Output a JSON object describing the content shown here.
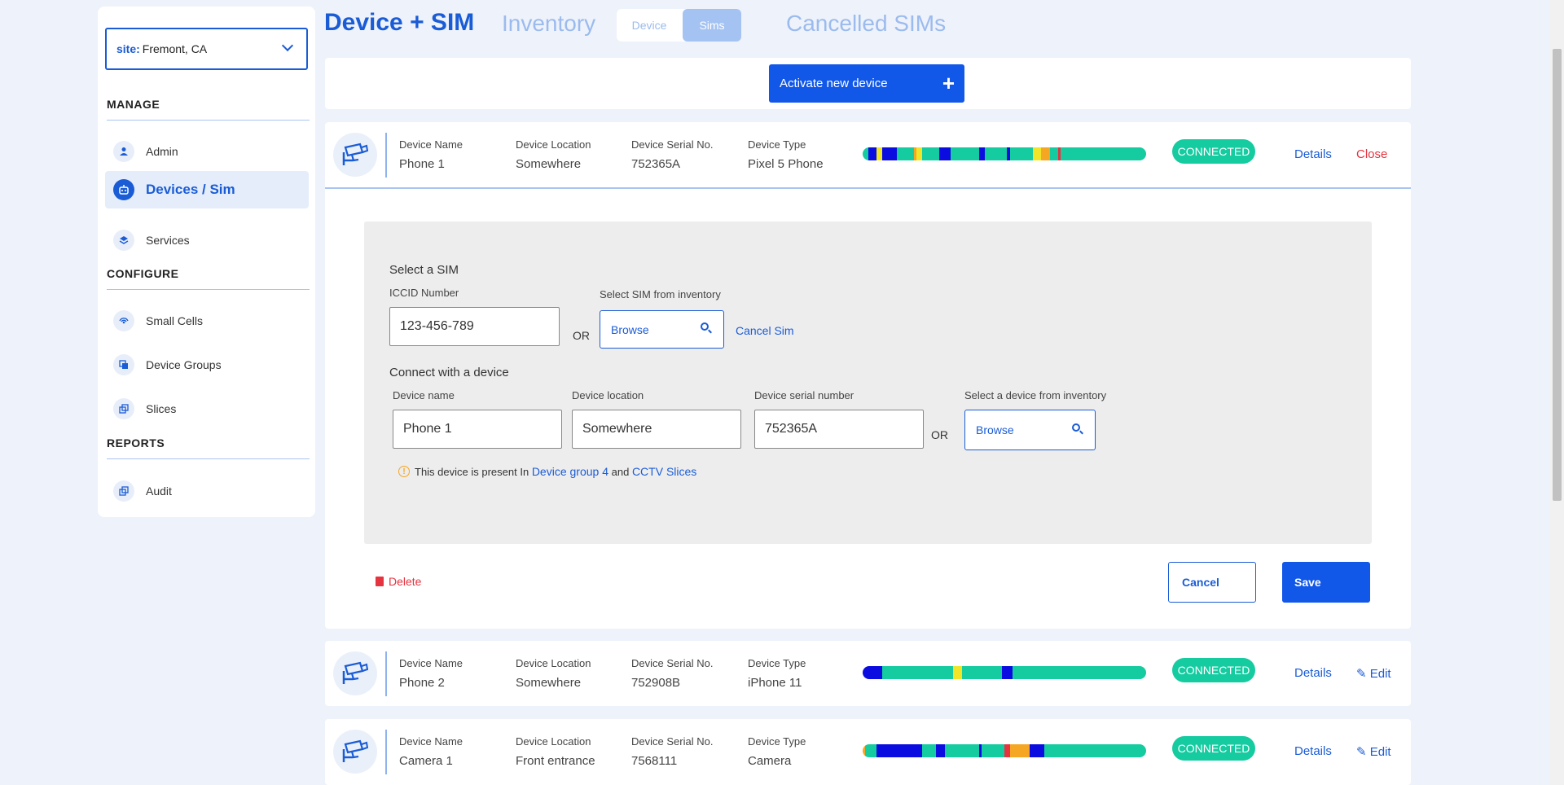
{
  "sidebar": {
    "site_label": "site:",
    "site_value": "Fremont, CA",
    "sections": {
      "manage": "MANAGE",
      "configure": "CONFIGURE",
      "reports": "REPORTS"
    },
    "items": {
      "admin": "Admin",
      "devices": "Devices / Sim",
      "services": "Services",
      "small_cells": "Small Cells",
      "device_groups": "Device Groups",
      "slices": "Slices",
      "audit": "Audit"
    }
  },
  "header": {
    "title": "Device + SIM",
    "inventory": "Inventory",
    "toggle_device": "Device",
    "toggle_sims": "Sims",
    "cancelled": "Cancelled SIMs"
  },
  "activate_button": "Activate new device",
  "field_labels": {
    "name": "Device Name",
    "location": "Device Location",
    "serial": "Device Serial No.",
    "type": "Device Type"
  },
  "devices": [
    {
      "name": "Phone 1",
      "location": "Somewhere",
      "serial": "752365A",
      "type": "Pixel 5 Phone",
      "status": "CONNECTED",
      "details": "Details",
      "action": "Close",
      "segments": [
        [
          "#15cba0",
          2
        ],
        [
          "#0b0de0",
          3
        ],
        [
          "#f0e528",
          2
        ],
        [
          "#0b0de0",
          5
        ],
        [
          "#15cba0",
          6
        ],
        [
          "#f5a623",
          1
        ],
        [
          "#f0e528",
          2
        ],
        [
          "#15cba0",
          6
        ],
        [
          "#0b0de0",
          4
        ],
        [
          "#15cba0",
          10
        ],
        [
          "#0b0de0",
          2
        ],
        [
          "#15cba0",
          8
        ],
        [
          "#0b0de0",
          1
        ],
        [
          "#15cba0",
          8
        ],
        [
          "#f0e528",
          3
        ],
        [
          "#f5a623",
          3
        ],
        [
          "#15cba0",
          3
        ],
        [
          "#e5333f",
          1
        ],
        [
          "#15cba0",
          30
        ]
      ]
    },
    {
      "name": "Phone 2",
      "location": "Somewhere",
      "serial": "752908B",
      "type": "iPhone 11",
      "status": "CONNECTED",
      "details": "Details",
      "action": "Edit",
      "segments": [
        [
          "#0b0de0",
          7
        ],
        [
          "#15cba0",
          25
        ],
        [
          "#f0e528",
          3
        ],
        [
          "#15cba0",
          14
        ],
        [
          "#0b0de0",
          4
        ],
        [
          "#15cba0",
          47
        ]
      ]
    },
    {
      "name": "Camera 1",
      "location": "Front entrance",
      "serial": "7568111",
      "type": "Camera",
      "status": "CONNECTED",
      "details": "Details",
      "action": "Edit",
      "segments": [
        [
          "#f5a623",
          1
        ],
        [
          "#15cba0",
          4
        ],
        [
          "#0b0de0",
          16
        ],
        [
          "#15cba0",
          5
        ],
        [
          "#0b0de0",
          3
        ],
        [
          "#15cba0",
          12
        ],
        [
          "#0b0de0",
          1
        ],
        [
          "#15cba0",
          8
        ],
        [
          "#e5333f",
          2
        ],
        [
          "#f5a623",
          7
        ],
        [
          "#0b0de0",
          5
        ],
        [
          "#15cba0",
          36
        ]
      ]
    }
  ],
  "form": {
    "select_sim": "Select a SIM",
    "iccid_label": "ICCID Number",
    "iccid_value": "123-456-789",
    "or": "OR",
    "sim_inventory_label": "Select SIM from inventory",
    "browse": "Browse",
    "cancel_sim": "Cancel Sim",
    "connect_label": "Connect with a device",
    "device_name_label": "Device name",
    "device_name_value": "Phone 1",
    "device_location_label": "Device location",
    "device_location_value": "Somewhere",
    "device_serial_label": "Device serial number",
    "device_serial_value": "752365A",
    "device_inventory_label": "Select a device from inventory",
    "note_prefix": "This device is present In",
    "note_group": "Device group 4",
    "note_and": "and",
    "note_slices": "CCTV Slices",
    "delete": "Delete",
    "cancel": "Cancel",
    "save": "Save"
  },
  "colors": {
    "primary": "#1157e8",
    "connected": "#15cba0",
    "danger": "#e5333f"
  }
}
